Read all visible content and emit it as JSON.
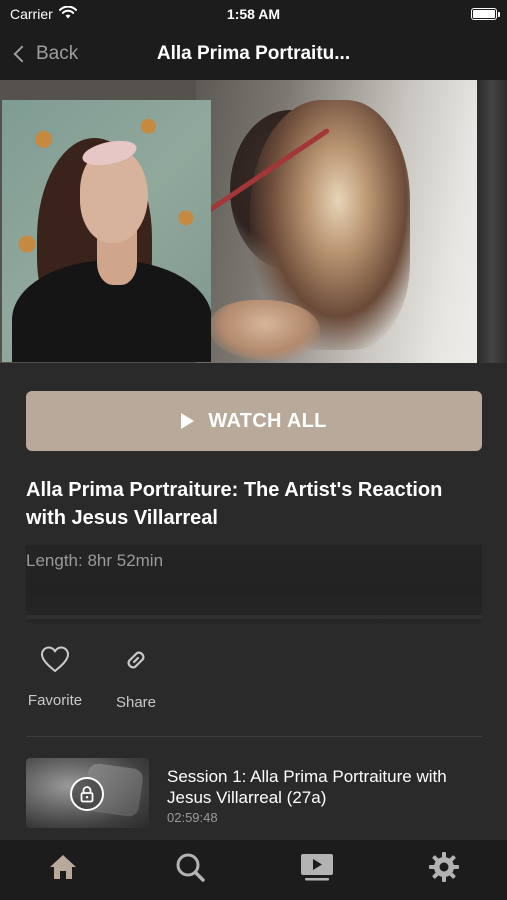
{
  "status_bar": {
    "carrier": "Carrier",
    "time": "1:58 AM",
    "battery_level": 1.0
  },
  "nav": {
    "back_label": "Back",
    "title": "Alla Prima Portraitu..."
  },
  "actions": {
    "watch_all_label": "WATCH ALL",
    "favorite_label": "Favorite",
    "share_label": "Share"
  },
  "course": {
    "title": "Alla Prima Portraiture: The Artist's Reaction with Jesus Villarreal",
    "length": "Length: 8hr 52min"
  },
  "sessions": [
    {
      "title": "Session 1: Alla Prima Portraiture with Jesus Villarreal (27a)",
      "duration": "02:59:48",
      "locked": true
    }
  ],
  "tab_bar": {
    "items": [
      {
        "icon": "home-icon",
        "active": true
      },
      {
        "icon": "search-icon",
        "active": false
      },
      {
        "icon": "video-library-icon",
        "active": false
      },
      {
        "icon": "settings-gear-icon",
        "active": false
      }
    ]
  },
  "colors": {
    "background": "#2a2a2a",
    "bar_background": "#1c1c1c",
    "accent": "#b8a99b",
    "active_tab": "#b8a99b",
    "muted_text": "#9a9a9a"
  }
}
